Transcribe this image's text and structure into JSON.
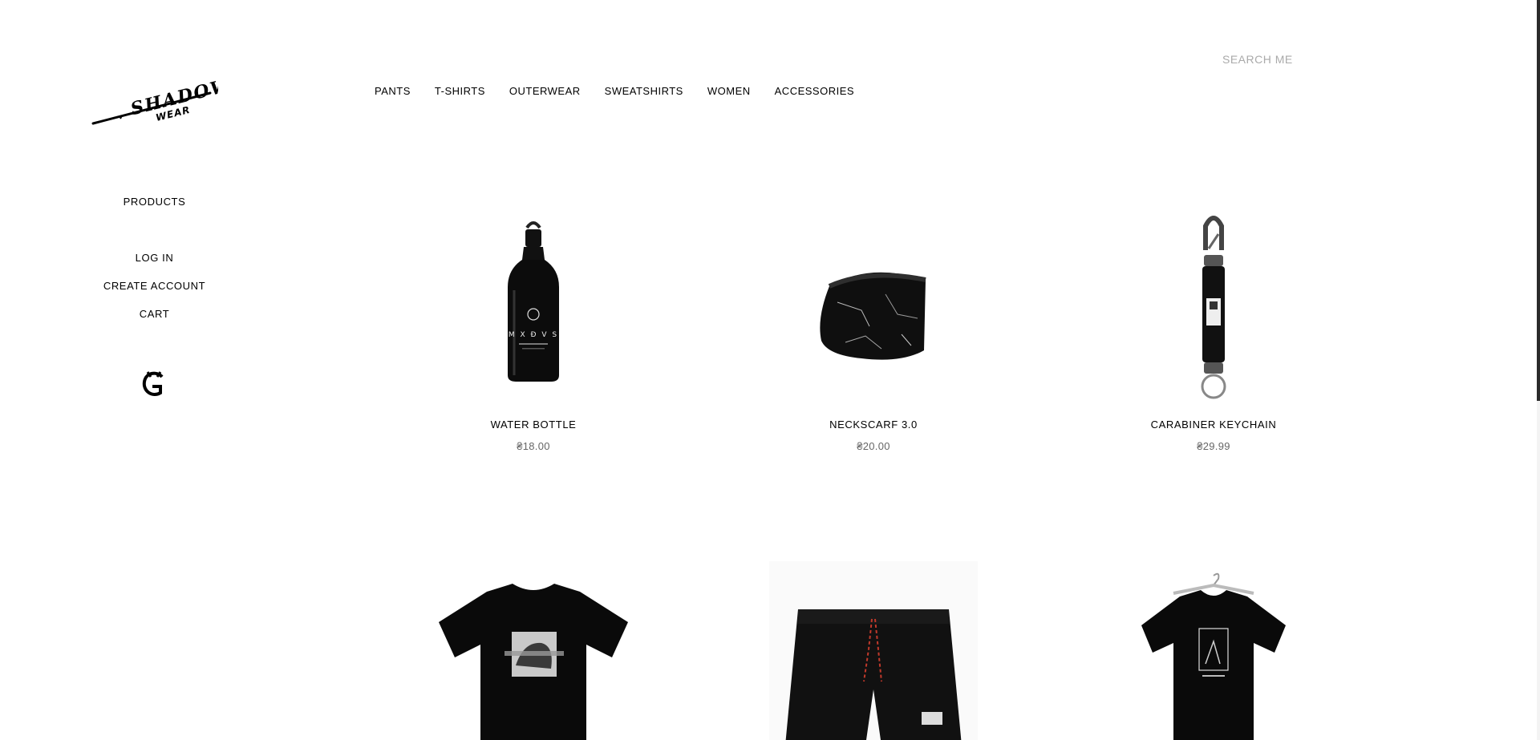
{
  "brand": {
    "logo_text": "SHADOW",
    "logo_subtext": "WEAR"
  },
  "top_nav": {
    "items": [
      "PANTS",
      "T-SHIRTS",
      "OUTERWEAR",
      "SWEATSHIRTS",
      "WOMEN",
      "ACCESSORIES"
    ]
  },
  "search": {
    "placeholder": "SEARCH ME"
  },
  "sidebar": {
    "products_label": "PRODUCTS",
    "login_label": "LOG IN",
    "create_account_label": "CREATE ACCOUNT",
    "cart_label": "CART",
    "brand_mark_icon": "gc-monogram-icon"
  },
  "products": [
    {
      "name": "WATER BOTTLE",
      "price": "₴18.00",
      "icon": "water-bottle-image",
      "bottle_text": "M X Ð V S"
    },
    {
      "name": "NECKSCARF 3.0",
      "price": "₴20.00",
      "icon": "neckscarf-image"
    },
    {
      "name": "CARABINER KEYCHAIN",
      "price": "₴29.99",
      "icon": "carabiner-keychain-image"
    },
    {
      "name": "",
      "price": "",
      "icon": "graphic-tshirt-image"
    },
    {
      "name": "",
      "price": "",
      "icon": "black-shorts-image"
    },
    {
      "name": "",
      "price": "",
      "icon": "hanging-tshirt-image"
    }
  ],
  "colors": {
    "text": "#000000",
    "price": "#666666",
    "placeholder": "#aaaaaa",
    "background": "#ffffff"
  }
}
